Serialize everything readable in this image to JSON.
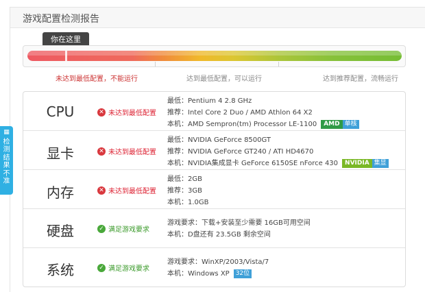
{
  "panel": {
    "title": "游戏配置检测报告"
  },
  "meter": {
    "tooltip": "你在这里",
    "level": 0.1,
    "levels": [
      {
        "label": "未达到最低配置，不能运行",
        "color": "#cc3333"
      },
      {
        "label": "达到最低配置，可以运行",
        "color": "#888888"
      },
      {
        "label": "达到推荐配置，流畅运行",
        "color": "#888888"
      }
    ]
  },
  "side_tab": {
    "icon": "grid-icon",
    "label": "检测结果不准"
  },
  "rows": [
    {
      "name": "CPU",
      "status": "未达到最低配置",
      "pass": false,
      "lines": [
        "最低：Pentium 4 2.8 GHz",
        "推荐：Intel Core 2 Duo / AMD Athlon 64 X2",
        "本机：AMD Sempron(tm) Processor LE-1100"
      ],
      "brand": "AMD",
      "tag": "单核"
    },
    {
      "name": "显卡",
      "status": "未达到最低配置",
      "pass": false,
      "lines": [
        "最低：NVIDIA GeForce 8500GT",
        "推荐：NVIDIA GeForce GT240 / ATI HD4670",
        "本机：NVIDIA集成显卡  GeForce 6150SE nForce 430"
      ],
      "brand": "NVIDIA",
      "tag": "集显"
    },
    {
      "name": "内存",
      "status": "未达到最低配置",
      "pass": false,
      "lines": [
        "最低：2GB",
        "推荐：3GB",
        "本机：1.0GB"
      ]
    },
    {
      "name": "硬盘",
      "status": "满足游戏要求",
      "pass": true,
      "lines": [
        "游戏要求：下载+安装至少需要  16GB可用空间",
        "本机：D盘还有  23.5GB 剩余空间"
      ]
    },
    {
      "name": "系统",
      "status": "满足游戏要求",
      "pass": true,
      "lines": [
        "游戏要求：WinXP/2003/Vista/7",
        "本机：Windows XP"
      ],
      "tag": "32位"
    }
  ],
  "colors": {
    "fail": "#d9383e",
    "pass": "#49a83a",
    "amd": "#2f9a46",
    "nvidia": "#7ab826",
    "tag": "#3fa0d8",
    "side_tab": "#2fb0e3"
  }
}
